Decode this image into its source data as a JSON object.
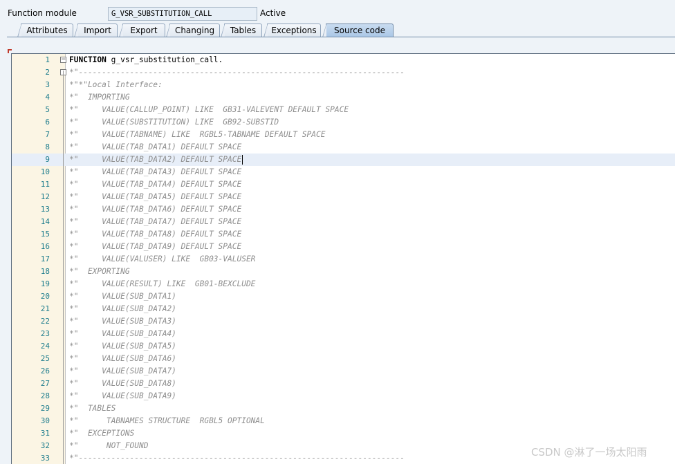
{
  "header": {
    "label": "Function module",
    "value": "G_VSR_SUBSTITUTION_CALL",
    "status": "Active"
  },
  "tabs": [
    {
      "label": "Attributes"
    },
    {
      "label": "Import"
    },
    {
      "label": "Export"
    },
    {
      "label": "Changing"
    },
    {
      "label": "Tables"
    },
    {
      "label": "Exceptions"
    },
    {
      "label": "Source code",
      "active": true
    }
  ],
  "editor": {
    "current_line": 9,
    "lines": [
      {
        "n": "1",
        "kw": "FUNCTION",
        "text": " g_vsr_substitution_call."
      },
      {
        "n": "2",
        "text": "*\"----------------------------------------------------------------------"
      },
      {
        "n": "3",
        "text": "*\"*\"Local Interface:"
      },
      {
        "n": "4",
        "text": "*\"  IMPORTING"
      },
      {
        "n": "5",
        "text": "*\"     VALUE(CALLUP_POINT) LIKE  GB31-VALEVENT DEFAULT SPACE"
      },
      {
        "n": "6",
        "text": "*\"     VALUE(SUBSTITUTION) LIKE  GB92-SUBSTID"
      },
      {
        "n": "7",
        "text": "*\"     VALUE(TABNAME) LIKE  RGBL5-TABNAME DEFAULT SPACE"
      },
      {
        "n": "8",
        "text": "*\"     VALUE(TAB_DATA1) DEFAULT SPACE"
      },
      {
        "n": "9",
        "text": "*\"     VALUE(TAB_DATA2) DEFAULT SPACE"
      },
      {
        "n": "10",
        "text": "*\"     VALUE(TAB_DATA3) DEFAULT SPACE"
      },
      {
        "n": "11",
        "text": "*\"     VALUE(TAB_DATA4) DEFAULT SPACE"
      },
      {
        "n": "12",
        "text": "*\"     VALUE(TAB_DATA5) DEFAULT SPACE"
      },
      {
        "n": "13",
        "text": "*\"     VALUE(TAB_DATA6) DEFAULT SPACE"
      },
      {
        "n": "14",
        "text": "*\"     VALUE(TAB_DATA7) DEFAULT SPACE"
      },
      {
        "n": "15",
        "text": "*\"     VALUE(TAB_DATA8) DEFAULT SPACE"
      },
      {
        "n": "16",
        "text": "*\"     VALUE(TAB_DATA9) DEFAULT SPACE"
      },
      {
        "n": "17",
        "text": "*\"     VALUE(VALUSER) LIKE  GB03-VALUSER"
      },
      {
        "n": "18",
        "text": "*\"  EXPORTING"
      },
      {
        "n": "19",
        "text": "*\"     VALUE(RESULT) LIKE  GB01-BEXCLUDE"
      },
      {
        "n": "20",
        "text": "*\"     VALUE(SUB_DATA1)"
      },
      {
        "n": "21",
        "text": "*\"     VALUE(SUB_DATA2)"
      },
      {
        "n": "22",
        "text": "*\"     VALUE(SUB_DATA3)"
      },
      {
        "n": "23",
        "text": "*\"     VALUE(SUB_DATA4)"
      },
      {
        "n": "24",
        "text": "*\"     VALUE(SUB_DATA5)"
      },
      {
        "n": "25",
        "text": "*\"     VALUE(SUB_DATA6)"
      },
      {
        "n": "26",
        "text": "*\"     VALUE(SUB_DATA7)"
      },
      {
        "n": "27",
        "text": "*\"     VALUE(SUB_DATA8)"
      },
      {
        "n": "28",
        "text": "*\"     VALUE(SUB_DATA9)"
      },
      {
        "n": "29",
        "text": "*\"  TABLES"
      },
      {
        "n": "30",
        "text": "*\"      TABNAMES STRUCTURE  RGBL5 OPTIONAL"
      },
      {
        "n": "31",
        "text": "*\"  EXCEPTIONS"
      },
      {
        "n": "32",
        "text": "*\"      NOT_FOUND"
      },
      {
        "n": "33",
        "text": "*\"----------------------------------------------------------------------"
      }
    ]
  },
  "watermark": "CSDN @淋了一场太阳雨",
  "colors": {
    "line_number": "#1b7b8c",
    "comment": "#8e8e8e",
    "active_tab": "#a9c6e6",
    "current_line": "#e7eef8"
  }
}
